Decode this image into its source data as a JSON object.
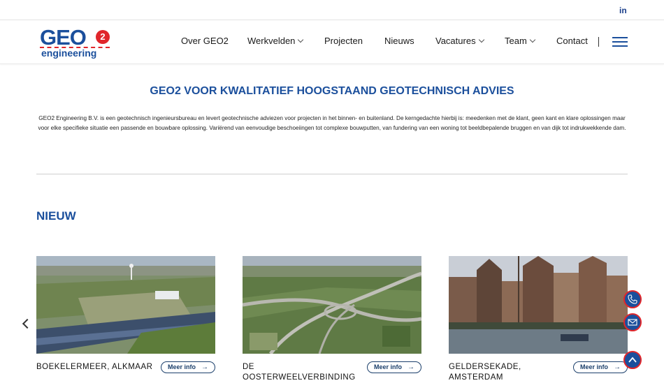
{
  "topbar": {
    "social": "in"
  },
  "logo": {
    "main": "GEO",
    "badge": "2",
    "sub": "engineering"
  },
  "nav": {
    "items": [
      {
        "label": "Over GEO2",
        "dropdown": false
      },
      {
        "label": "Werkvelden",
        "dropdown": true
      },
      {
        "label": "Projecten",
        "dropdown": false
      },
      {
        "label": "Nieuws",
        "dropdown": false
      },
      {
        "label": "Vacatures",
        "dropdown": true
      },
      {
        "label": "Team",
        "dropdown": true
      },
      {
        "label": "Contact",
        "dropdown": false
      }
    ]
  },
  "hero": {
    "title": "GEO2 VOOR KWALITATIEF HOOGSTAAND GEOTECHNISCH ADVIES",
    "intro": "GEO2 Engineering B.V. is een geotechnisch ingenieursbureau en levert geotechnische adviezen voor projecten in het binnen- en buitenland. De kerngedachte hierbij is: meedenken met de klant, geen kant en klare oplossingen maar voor elke specifieke situatie een passende en bouwbare oplossing. Variërend van eenvoudige beschoeiingen tot complexe bouwputten, van fundering van een woning tot beeldbepalende bruggen en van dijk tot indrukwekkende dam."
  },
  "news": {
    "heading": "NIEUW",
    "more_label": "Meer info",
    "cards": [
      {
        "title": "BOEKELERMEER, ALKMAAR"
      },
      {
        "title": "DE OOSTERWEELVERBINDING"
      },
      {
        "title": "GELDERSEKADE, AMSTERDAM"
      }
    ]
  },
  "colors": {
    "brand_blue": "#1b4f9c",
    "brand_red": "#e0262b"
  }
}
